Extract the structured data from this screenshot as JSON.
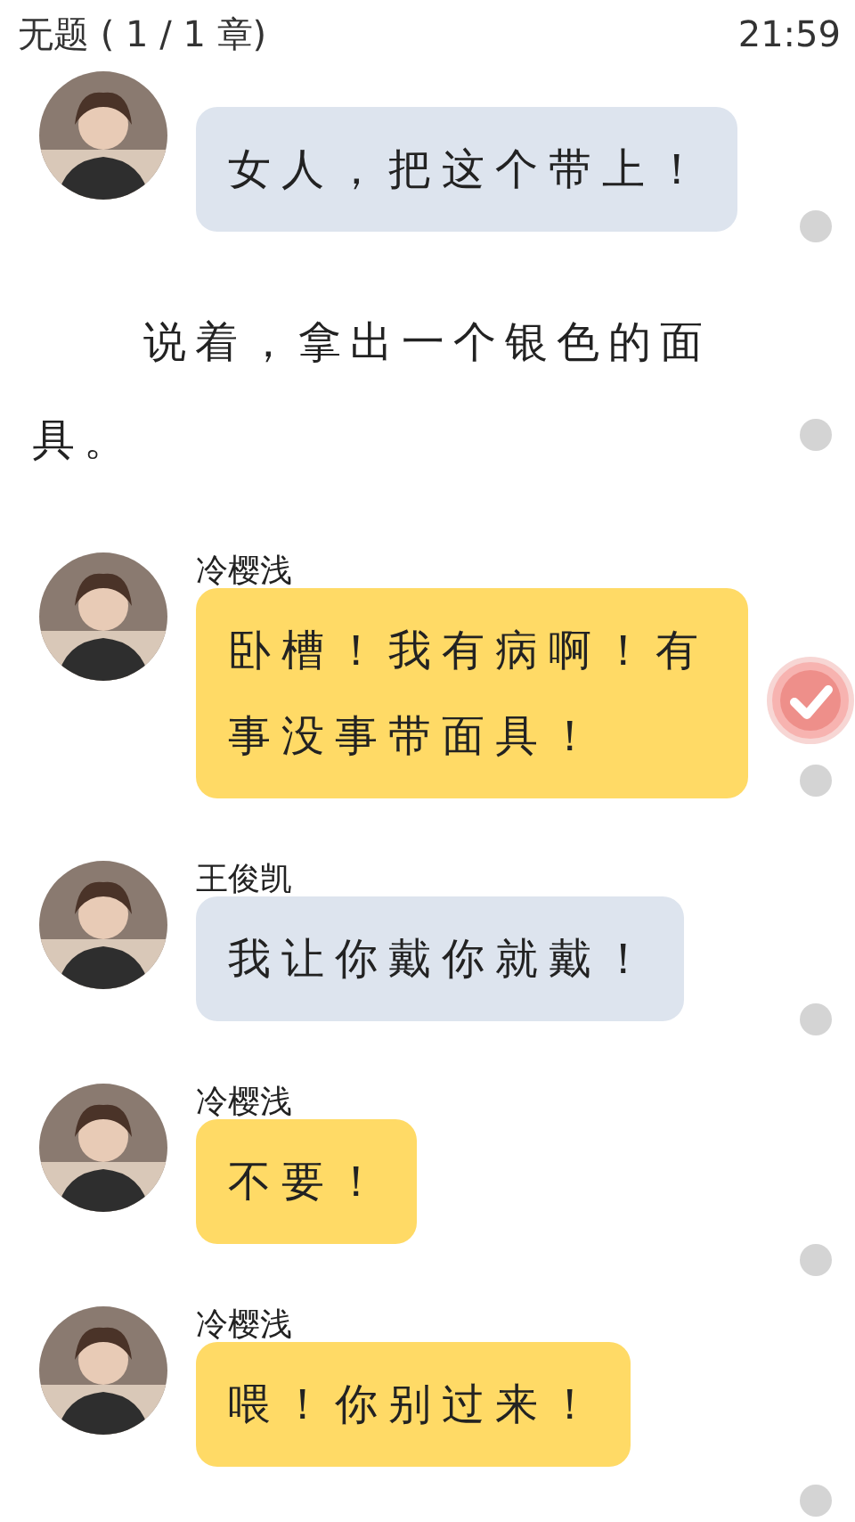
{
  "header": {
    "title": "无题 ( 1 / 1 章)",
    "time": "21:59"
  },
  "items": [
    {
      "kind": "message",
      "color": "#dde4ee",
      "text": "女人，把这个带上！"
    },
    {
      "kind": "narration",
      "text": "说着，拿出一个银色的面具。"
    },
    {
      "kind": "message",
      "name": "冷樱浅",
      "color": "#ffda66",
      "text": "卧槽！我有病啊！有事没事带面具！"
    },
    {
      "kind": "message",
      "name": "王俊凯",
      "color": "#dde4ee",
      "text": "我让你戴你就戴！"
    },
    {
      "kind": "message",
      "name": "冷樱浅",
      "color": "#ffda66",
      "text": "不要！"
    },
    {
      "kind": "message",
      "name": "冷樱浅",
      "color": "#ffda66",
      "text": "喂！你别过来！"
    }
  ]
}
